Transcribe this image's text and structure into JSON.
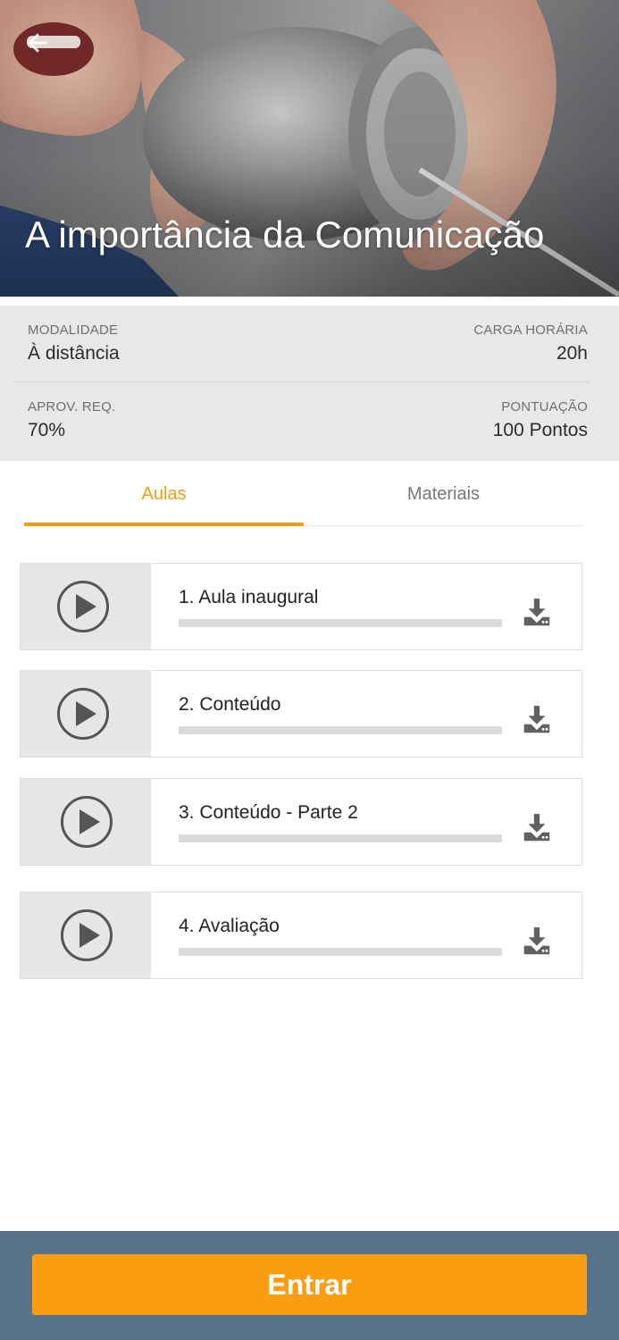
{
  "header": {
    "back_icon": "arrow-left-icon",
    "title": "A importância da Comunicação",
    "image_subject": "person speaking into tin-can telephone"
  },
  "info": {
    "rows": [
      {
        "left": {
          "label": "MODALIDADE",
          "value": "À distância"
        },
        "right": {
          "label": "CARGA HORÁRIA",
          "value": "20h"
        }
      },
      {
        "left": {
          "label": "APROV. REQ.",
          "value": "70%"
        },
        "right": {
          "label": "PONTUAÇÃO",
          "value": "100 Pontos"
        }
      }
    ]
  },
  "tabs": [
    {
      "label": "Aulas",
      "active": true
    },
    {
      "label": "Materiais",
      "active": false
    }
  ],
  "lessons": [
    {
      "title": "1. Aula inaugural",
      "progress": 0,
      "play_icon": "play-circle-icon",
      "download_icon": "download-icon"
    },
    {
      "title": "2. Conteúdo",
      "progress": 0,
      "play_icon": "play-circle-icon",
      "download_icon": "download-icon"
    },
    {
      "title": "3. Conteúdo - Parte 2",
      "progress": 0,
      "play_icon": "play-circle-icon",
      "download_icon": "download-icon"
    },
    {
      "title": "4. Avaliação",
      "progress": 0,
      "play_icon": "play-circle-icon",
      "download_icon": "download-icon"
    }
  ],
  "footer": {
    "button_label": "Entrar"
  },
  "colors": {
    "accent": "#f59c12",
    "footer_bg": "#587389",
    "button_bg": "#fb9d10",
    "info_bg": "#e8e8e8"
  }
}
